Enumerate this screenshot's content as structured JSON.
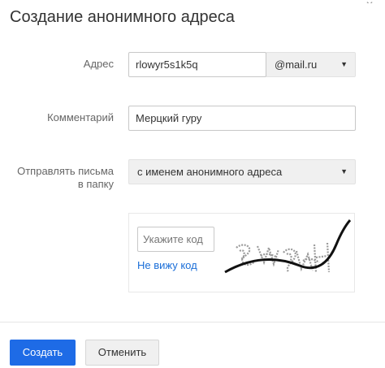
{
  "dialog": {
    "title": "Создание анонимного адреса"
  },
  "address": {
    "label": "Адрес",
    "value": "rlowyr5s1k5q",
    "domain": "@mail.ru"
  },
  "comment": {
    "label": "Комментарий",
    "value": "Мерцкий гуру"
  },
  "folder": {
    "label_line1": "Отправлять письма",
    "label_line2": "в папку",
    "selected": "с именем анонимного адреса"
  },
  "captcha": {
    "placeholder": "Укажите код",
    "cant_see_link": "Не вижу код"
  },
  "buttons": {
    "create": "Создать",
    "cancel": "Отменить"
  },
  "colors": {
    "primary": "#1e6be6",
    "link": "#1a6ed8"
  }
}
